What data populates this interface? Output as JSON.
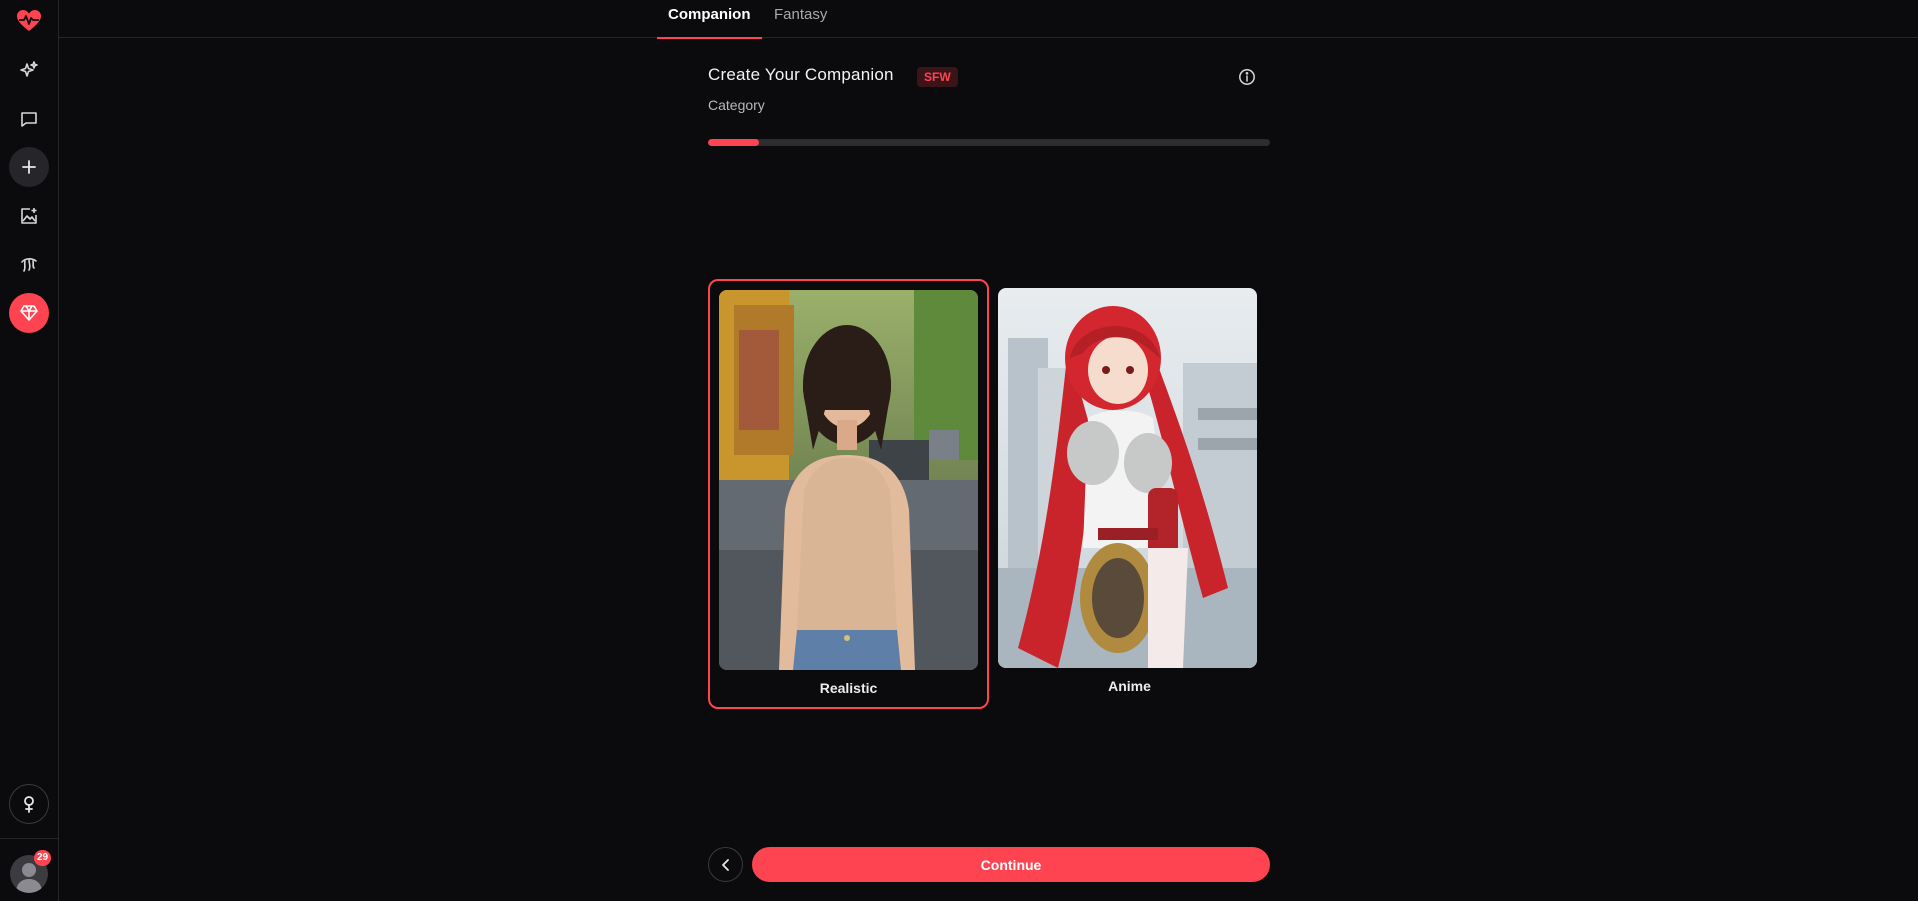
{
  "sidebar": {
    "items": [
      {
        "icon": "heart-pulse-icon"
      },
      {
        "icon": "sparkles-icon"
      },
      {
        "icon": "chat-icon"
      },
      {
        "icon": "plus-icon"
      },
      {
        "icon": "image-edit-icon"
      },
      {
        "icon": "tentacles-icon"
      },
      {
        "icon": "diamond-icon"
      }
    ],
    "bottom": {
      "icon": "female-symbol-icon"
    },
    "notifications": "29"
  },
  "tabs": [
    {
      "label": "Companion",
      "active": true
    },
    {
      "label": "Fantasy",
      "active": false
    }
  ],
  "panel": {
    "title": "Create Your Companion",
    "badge": "SFW",
    "subtitle": "Category",
    "progress": 0.09
  },
  "cards": [
    {
      "label": "Realistic",
      "selected": true
    },
    {
      "label": "Anime",
      "selected": false
    }
  ],
  "footer": {
    "continue_label": "Continue"
  },
  "colors": {
    "accent": "#ff4451",
    "background": "#0b0b0d"
  }
}
